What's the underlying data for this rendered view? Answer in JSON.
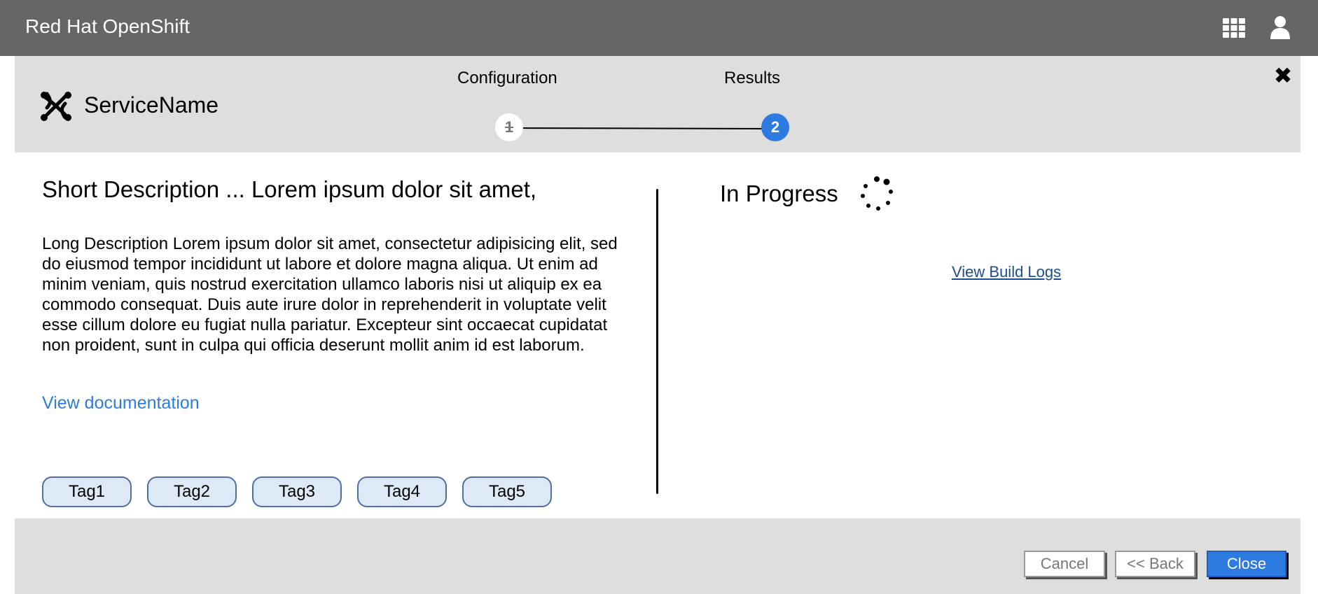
{
  "app": {
    "title": "Red Hat OpenShift",
    "icons": [
      "grid-icon",
      "user-icon"
    ]
  },
  "wizard": {
    "service_name": "ServiceName",
    "service_icon": "service-icon",
    "steps": [
      {
        "label": "Configuration",
        "number": "1",
        "state": "completed"
      },
      {
        "label": "Results",
        "number": "2",
        "state": "active"
      }
    ],
    "close_icon": "close-icon",
    "accent_color": "#2d7be0"
  },
  "details": {
    "short_description": "Short Description ... Lorem ipsum dolor sit amet,",
    "long_description": "Long Description Lorem ipsum dolor sit amet, consectetur adipisicing elit, sed do eiusmod tempor incididunt ut labore et dolore magna aliqua. Ut enim ad minim veniam, quis nostrud exercitation ullamco laboris nisi ut aliquip ex ea commodo consequat. Duis aute irure dolor in reprehenderit in voluptate velit esse cillum dolore eu fugiat nulla pariatur. Excepteur sint occaecat cupidatat non proident, sunt in culpa qui officia deserunt mollit anim id est laborum.",
    "doc_link": "View documentation",
    "tags": [
      "Tag1",
      "Tag2",
      "Tag3",
      "Tag4",
      "Tag5"
    ]
  },
  "results": {
    "status": "In Progress",
    "status_icon": "spinner-icon",
    "build_logs_link": "View Build Logs"
  },
  "footer": {
    "cancel_label": "Cancel",
    "back_label": "<< Back",
    "close_label": "Close"
  }
}
